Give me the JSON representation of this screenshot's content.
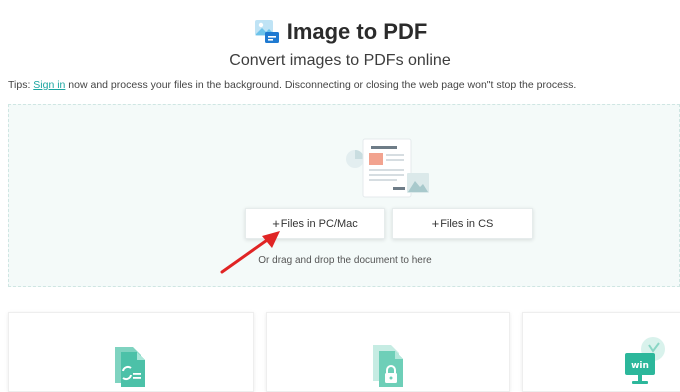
{
  "header": {
    "title": "Image to PDF",
    "subtitle": "Convert images to PDFs online"
  },
  "tips": {
    "prefix": "Tips: ",
    "link": "Sign in",
    "suffix": " now and process your files in the background. Disconnecting or closing the web page won\"t stop the process."
  },
  "upload": {
    "btn_pc_label": "Files in PC/Mac",
    "btn_cs_label": "Files in CS",
    "plus_symbol": "+",
    "drag_text": "Or drag and drop the document to here"
  },
  "cards": [
    {
      "icon": "convert-doc-icon"
    },
    {
      "icon": "lock-doc-icon"
    },
    {
      "icon": "windows-monitor-icon",
      "badge": "win"
    }
  ],
  "colors": {
    "accent": "#1aa5a0",
    "dropzone_bg": "#f4faf9",
    "arrow": "#e02424"
  }
}
